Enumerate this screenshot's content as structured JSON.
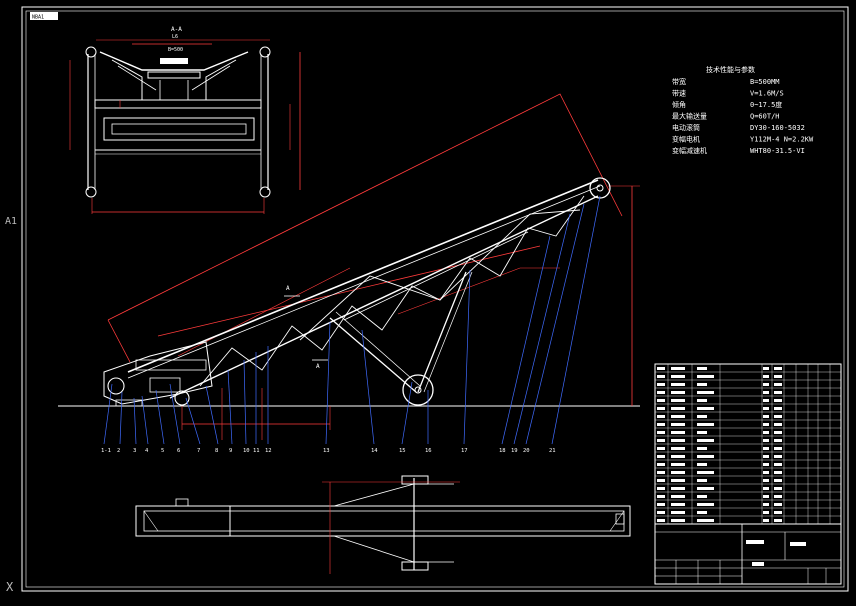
{
  "sheet": {
    "size_label": "A1",
    "corner_label": "X",
    "title_stamp": "NBA1"
  },
  "section_view": {
    "section_label": "A-A",
    "section_sub": "L6",
    "width_label": "B=500"
  },
  "tech_specs": {
    "title": "技术性能与参数",
    "rows": [
      {
        "name": "带宽",
        "value": "B=500MM"
      },
      {
        "name": "带速",
        "value": "V=1.6M/S"
      },
      {
        "name": "倾角",
        "value": "0~17.5度"
      },
      {
        "name": "最大输送量",
        "value": "Q=60T/H"
      },
      {
        "name": "电动滚筒",
        "value": "DY30-160-5032"
      },
      {
        "name": "变幅电机",
        "value": "Y112M-4 N=2.2KW"
      },
      {
        "name": "变幅减速机",
        "value": "WHT80-31.5-VI"
      }
    ]
  },
  "part_numbers": [
    "1-1",
    "2",
    "3",
    "4",
    "5",
    "6",
    "7",
    "8",
    "9",
    "10",
    "11",
    "12",
    "13",
    "14",
    "15",
    "16",
    "17",
    "18",
    "19",
    "20",
    "21"
  ],
  "section_markers": [
    "A",
    "A"
  ],
  "colors": {
    "frame": "#ffffff",
    "dimension": "#ff3b3b",
    "leader": "#3f6bff",
    "steel": "#ffffff",
    "background": "#000000"
  }
}
